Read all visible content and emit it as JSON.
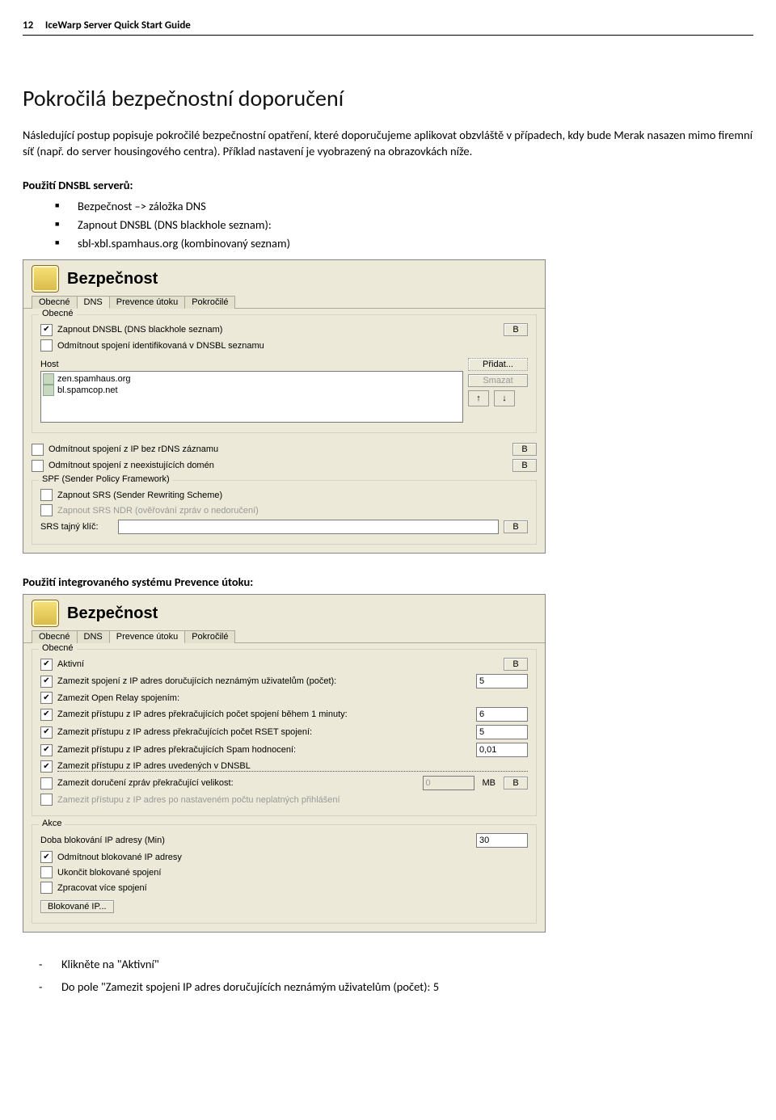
{
  "header": {
    "page_no": "12",
    "title": "IceWarp Server Quick Start Guide"
  },
  "h1": "Pokročilá bezpečnostní doporučení",
  "intro": "Následující postup popisuje pokročilé bezpečnostní opatření, které doporučujeme aplikovat obzvláště v případech, kdy bude Merak nasazen mimo firemní síť (např. do server housingového centra). Příklad nastavení je vyobrazený na obrazovkách níže.",
  "dnsbl": {
    "heading": "Použití DNSBL serverů:",
    "items": [
      "Bezpečnost –> záložka DNS",
      "Zapnout DNSBL (DNS blackhole seznam):",
      "sbl-xbl.spamhaus.org (kombinovaný seznam)"
    ]
  },
  "panel1": {
    "title": "Bezpečnost",
    "tabs": [
      "Obecné",
      "DNS",
      "Prevence útoku",
      "Pokročilé"
    ],
    "active_tab": "DNS",
    "grp1": {
      "legend": "Obecné",
      "chk_dnsbl": "Zapnout DNSBL (DNS blackhole seznam)",
      "chk_reject": "Odmítnout spojení identifikovaná v DNSBL seznamu",
      "b": "B",
      "host_label": "Host",
      "hosts": [
        "zen.spamhaus.org",
        "bl.spamcop.net"
      ],
      "btn_add": "Přidat...",
      "btn_del": "Smazat"
    },
    "chk_rdns": "Odmítnout spojení z IP bez rDNS záznamu",
    "chk_nxdom": "Odmítnout spojení z neexistujících domén",
    "spf": {
      "legend": "SPF (Sender Policy Framework)",
      "srs": "Zapnout SRS (Sender Rewriting Scheme)",
      "srs_ndr": "Zapnout SRS NDR (ověřování zpráv o nedoručení)",
      "keylabel": "SRS tajný klíč:"
    }
  },
  "prev_heading": "Použití integrovaného systému Prevence útoku:",
  "panel2": {
    "title": "Bezpečnost",
    "tabs": [
      "Obecné",
      "DNS",
      "Prevence útoku",
      "Pokročilé"
    ],
    "active_tab": "Prevence útoku",
    "obecne": {
      "legend": "Obecné",
      "c1": "Aktivní",
      "c2": "Zamezit spojení z IP adres doručujících neznámým uživatelům (počet):",
      "v2": "5",
      "c3": "Zamezit Open Relay spojením:",
      "c4": "Zamezit přístupu z IP adres překračujících počet spojení během 1 minuty:",
      "v4": "6",
      "c5": "Zamezit přístupu z IP adress překračujících počet RSET spojení:",
      "v5": "5",
      "c6": "Zamezit přístupu z IP adres překračujících Spam hodnocení:",
      "v6": "0,01",
      "c7": "Zamezit přístupu z IP adres uvedených v DNSBL",
      "c8": "Zamezit doručení zpráv překračující velikost:",
      "v8": "0",
      "u8": "MB",
      "c9": "Zamezit přístupu z IP adres po nastaveném počtu neplatných přihlášení"
    },
    "akce": {
      "legend": "Akce",
      "l1": "Doba blokování IP adresy (Min)",
      "v1": "30",
      "c1": "Odmítnout blokované IP adresy",
      "c2": "Ukončit blokované spojení",
      "c3": "Zpracovat více spojení",
      "btn": "Blokované IP..."
    }
  },
  "foot": {
    "d1": "Klikněte na \"Aktivní\"",
    "d2": "Do pole \"Zamezit spojeni IP adres doručujících neznámým uživatelům (počet): 5"
  }
}
